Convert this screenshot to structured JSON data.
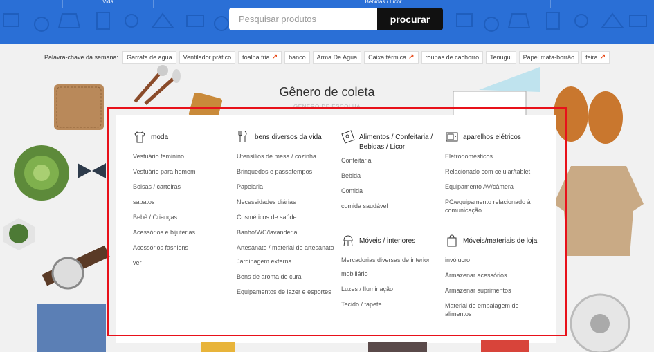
{
  "header": {
    "nav": [
      "Vida",
      "",
      "Bebidas / Licor"
    ],
    "search_placeholder": "Pesquisar produtos",
    "search_button": "procurar"
  },
  "keywords": {
    "label": "Palavra-chave da semana:",
    "items": [
      {
        "text": "Garrafa de agua",
        "hot": false
      },
      {
        "text": "Ventilador prático",
        "hot": false
      },
      {
        "text": "toalha fria",
        "hot": true
      },
      {
        "text": "banco",
        "hot": false
      },
      {
        "text": "Arma De Agua",
        "hot": false
      },
      {
        "text": "Caixa térmica",
        "hot": true
      },
      {
        "text": "roupas de cachorro",
        "hot": false
      },
      {
        "text": "Tenugui",
        "hot": false
      },
      {
        "text": "Papel mata-borrão",
        "hot": false
      },
      {
        "text": "feira",
        "hot": true
      }
    ]
  },
  "section": {
    "title": "Gênero de coleta",
    "subtitle": "GÊNERO DE ESCOLHA"
  },
  "categories": [
    {
      "name": "moda",
      "icon": "shirt-icon",
      "items": [
        "Vestuário feminino",
        "Vestuário para homem",
        "Bolsas / carteiras",
        "sapatos",
        "Bebê / Crianças",
        "Acessórios e bijuterias",
        "Acessórios fashions",
        "ver"
      ]
    },
    {
      "name": "bens diversos da vida",
      "icon": "utensils-icon",
      "items": [
        "Utensílios de mesa / cozinha",
        "Brinquedos e passatempos",
        "Papelaria",
        "Necessidades diárias",
        "Cosméticos de saúde",
        "Banho/WC/lavanderia",
        "Artesanato / material de artesanato",
        "Jardinagem externa",
        "Bens de aroma de cura",
        "Equipamentos de lazer e esportes"
      ]
    },
    {
      "name": "Alimentos / Confeitaria / Bebidas / Licor",
      "icon": "food-icon",
      "items": [
        "Confeitaria",
        "Bebida",
        "Comida",
        "comida saudável"
      ]
    },
    {
      "name": "aparelhos elétricos",
      "icon": "microwave-icon",
      "items": [
        "Eletrodomésticos",
        "Relacionado com celular/tablet",
        "Equipamento AV/câmera",
        "PC/equipamento relacionado à comunicação"
      ]
    },
    {
      "name": "Móveis / interiores",
      "icon": "chair-icon",
      "items": [
        "Mercadorias diversas de interior",
        "mobiliário",
        "Luzes / Iluminação",
        "Tecido / tapete"
      ]
    },
    {
      "name": "Móveis/materiais de loja",
      "icon": "shop-bag-icon",
      "items": [
        "invólucro",
        "Armazenar acessórios",
        "Armazenar suprimentos",
        "Material de embalagem de alimentos"
      ]
    }
  ]
}
